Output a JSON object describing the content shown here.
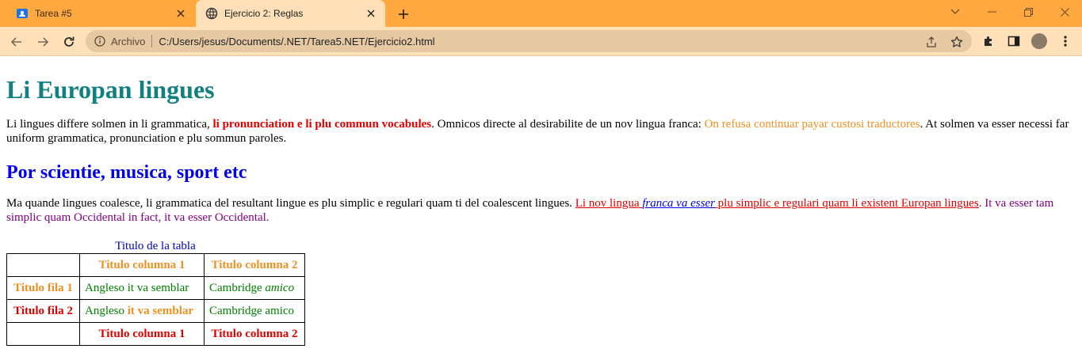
{
  "browser": {
    "tabs": [
      {
        "title": "Tarea #5",
        "active": false
      },
      {
        "title": "Ejercicio 2: Reglas",
        "active": true
      }
    ],
    "address": {
      "label": "Archivo",
      "url": "C:/Users/jesus/Documents/.NET/Tarea5.NET/Ejercicio2.html"
    },
    "colors": {
      "tabbar": "#ffa940",
      "toolbar": "#ffe0b8",
      "omnibox": "#e6c8a2"
    }
  },
  "page": {
    "h1": "Li Europan lingues",
    "p1": {
      "t1": "Li lingues differe solmen in li grammatica, ",
      "bold_red": "li pronunciation e li plu commun vocabules",
      "t2": ". Omnicos directe al desirabilite de un nov lingua franca: ",
      "orange": "On refusa continuar payar custosi traductores",
      "t3": ". At solmen va esser necessi far uniform grammatica, pronunciation e plu sommun paroles."
    },
    "h2": "Por scientie, musica, sport etc",
    "p2": {
      "t1": "Ma quande lingues coalesce, li grammatica del resultant lingue es plu simplic e regulari quam ti del coalescent lingues. ",
      "link1": "Li nov lingua ",
      "link_italic": "franca va esser",
      "link2": " plu simplic e regulari quam li existent Europan lingues",
      "purple": ". It va esser tam simplic quam Occidental in fact, it va esser Occidental."
    },
    "table": {
      "caption": "Titulo de la tabla",
      "header": [
        "",
        "Titulo columna 1",
        "Titulo columna 2"
      ],
      "row1": {
        "head": "Titulo fila 1",
        "c1": "Angleso it va semblar",
        "c2_plain": "Cambridge ",
        "c2_italic": "amico"
      },
      "row2": {
        "head": "Titulo fila 2",
        "c1_plain": "Angleso ",
        "c1_bold": "it va semblar",
        "c2": "Cambridge amico"
      },
      "footer": [
        "",
        "Titulo columna 1",
        "Titulo columna 2"
      ]
    }
  }
}
